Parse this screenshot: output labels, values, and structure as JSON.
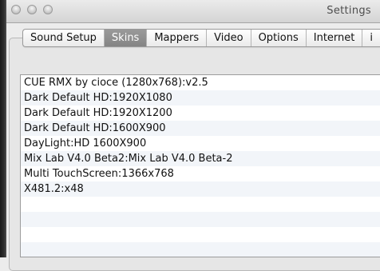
{
  "window": {
    "title": "Settings"
  },
  "tabs": [
    {
      "label": "Sound Setup",
      "active": false
    },
    {
      "label": "Skins",
      "active": true
    },
    {
      "label": "Mappers",
      "active": false
    },
    {
      "label": "Video",
      "active": false
    },
    {
      "label": "Options",
      "active": false
    },
    {
      "label": "Internet",
      "active": false
    },
    {
      "label": "i",
      "active": false
    }
  ],
  "skins_list": [
    "CUE RMX by cioce (1280x768):v2.5",
    "Dark Default HD:1920X1080",
    "Dark Default HD:1920X1200",
    "Dark Default HD:1600X900",
    "DayLight:HD 1600X900",
    "Mix Lab V4.0 Beta2:Mix Lab V4.0 Beta-2",
    "Multi TouchScreen:1366x768",
    "X481.2:x48",
    "",
    "",
    "",
    ""
  ],
  "colors": {
    "active_tab": "#8f8f8f",
    "window_bg": "#ececec",
    "list_alt_row": "#f2f5f9"
  }
}
